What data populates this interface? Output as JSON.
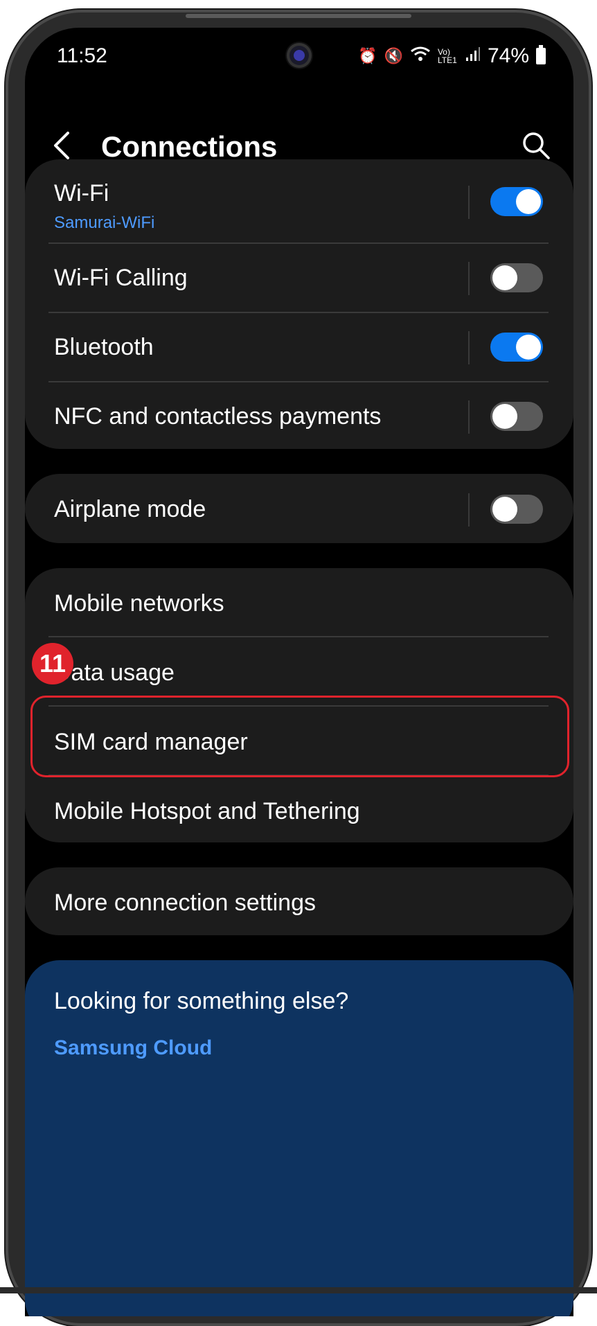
{
  "status_bar": {
    "time": "11:52",
    "icons": [
      "alarm-icon",
      "mute-icon",
      "wifi-icon",
      "volte-icon",
      "signal-icon"
    ],
    "volte_label": "Vo) LTE1",
    "battery_percent": "74%"
  },
  "header": {
    "title": "Connections"
  },
  "group1": [
    {
      "label": "Wi-Fi",
      "sub": "Samurai-WiFi",
      "toggle": true
    },
    {
      "label": "Wi-Fi Calling",
      "toggle": false
    },
    {
      "label": "Bluetooth",
      "toggle": true
    },
    {
      "label": "NFC and contactless payments",
      "toggle": false
    }
  ],
  "group2": [
    {
      "label": "Airplane mode",
      "toggle": false
    }
  ],
  "group3": [
    {
      "label": "Mobile networks"
    },
    {
      "label": "Data usage"
    },
    {
      "label": "SIM card manager"
    },
    {
      "label": "Mobile Hotspot and Tethering"
    }
  ],
  "group4": [
    {
      "label": "More connection settings"
    }
  ],
  "looking": {
    "title": "Looking for something else?",
    "link": "Samsung Cloud"
  },
  "annotation": {
    "step_number": "11"
  },
  "colors": {
    "accent_blue": "#0b79f0",
    "link_blue": "#4e9bff",
    "highlight_red": "#e0232c",
    "card_bg": "#1c1c1c",
    "looking_bg": "#0e3360"
  }
}
